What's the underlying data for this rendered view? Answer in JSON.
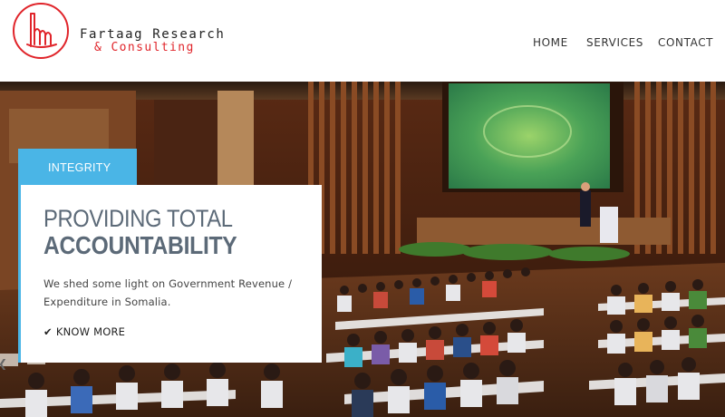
{
  "brand": {
    "name_line1": "Fartaag Research",
    "name_line2": "& Consulting",
    "logo_icon": "hand-logo-icon",
    "colors": {
      "brand_red": "#e0242a",
      "accent_blue": "#4ab5e6",
      "title_gray": "#5c6a78"
    }
  },
  "nav": {
    "items": [
      {
        "label": "HOME"
      },
      {
        "label": "SERVICES"
      },
      {
        "label": "CONTACT"
      }
    ]
  },
  "hero": {
    "tag": "INTEGRITY",
    "title_line1": "PROVIDING TOTAL",
    "title_line2": "ACCOUNTABILITY",
    "description": "We shed some light on Government Revenue / Expenditure in Somalia.",
    "cta_label": "KNOW MORE",
    "cta_icon": "check-icon",
    "image_alt": "conference-hall-photo"
  }
}
